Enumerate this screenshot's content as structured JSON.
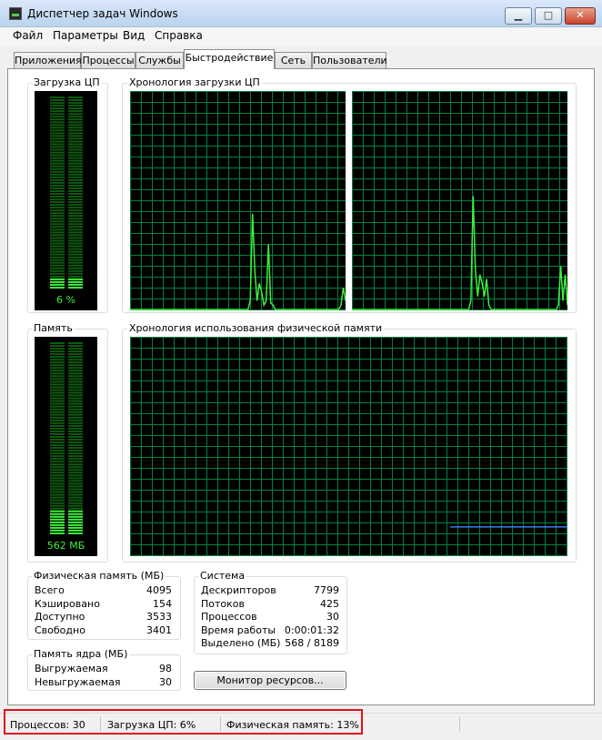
{
  "window": {
    "title": "Диспетчер задач Windows",
    "minimize": "▁",
    "maximize": "□",
    "close": "✕",
    "icon": "task-manager-icon"
  },
  "menu": [
    "Файл",
    "Параметры",
    "Вид",
    "Справка"
  ],
  "tabs": [
    "Приложения",
    "Процессы",
    "Службы",
    "Быстродействие",
    "Сеть",
    "Пользователи"
  ],
  "active_tab": "Быстродействие",
  "cpu": {
    "group_label": "Загрузка ЦП",
    "value_text": "6 %",
    "percent": 6,
    "history_label": "Хронология загрузки ЦП",
    "core1": [
      0,
      0,
      0,
      0,
      0,
      0,
      0,
      0,
      0,
      0,
      0,
      0,
      0,
      0,
      0,
      0,
      0,
      0,
      0,
      0,
      0,
      0,
      0,
      0,
      0,
      0,
      0,
      0,
      0,
      0,
      0,
      0,
      0,
      0,
      0,
      0,
      0,
      0,
      0,
      0,
      0,
      0,
      0,
      0,
      0,
      0,
      0,
      0,
      0,
      0,
      0,
      0,
      0,
      4,
      44,
      18,
      4,
      12,
      8,
      2,
      4,
      30,
      3,
      2,
      0,
      0,
      0,
      0,
      0,
      0,
      0,
      0,
      0,
      0,
      0,
      0,
      0,
      0,
      0,
      0,
      0,
      0,
      0,
      0,
      0,
      0,
      0,
      0,
      0,
      0,
      0,
      0,
      0,
      2,
      10,
      4
    ],
    "core2": [
      0,
      0,
      0,
      0,
      0,
      0,
      0,
      0,
      0,
      0,
      0,
      0,
      0,
      0,
      0,
      0,
      0,
      0,
      0,
      0,
      0,
      0,
      0,
      0,
      0,
      0,
      0,
      0,
      0,
      0,
      0,
      0,
      0,
      0,
      0,
      0,
      0,
      0,
      0,
      0,
      0,
      0,
      0,
      0,
      0,
      0,
      0,
      0,
      0,
      0,
      0,
      0,
      0,
      4,
      52,
      18,
      6,
      16,
      12,
      6,
      14,
      2,
      0,
      0,
      0,
      0,
      0,
      0,
      0,
      0,
      0,
      0,
      0,
      0,
      0,
      0,
      0,
      0,
      0,
      0,
      0,
      0,
      0,
      0,
      0,
      0,
      0,
      0,
      0,
      0,
      0,
      0,
      2,
      20,
      4,
      16,
      2
    ]
  },
  "memory": {
    "group_label": "Память",
    "value_text": "562 МБ",
    "percent": 13,
    "history_label": "Хронология использования физической памяти",
    "history": [
      0,
      0,
      0,
      0,
      0,
      0,
      0,
      0,
      0,
      0,
      0,
      0,
      0,
      0,
      0,
      0,
      0,
      0,
      0,
      0,
      0,
      0,
      0,
      0,
      0,
      0,
      0,
      0,
      0,
      0,
      0,
      0,
      0,
      0,
      0,
      0,
      0,
      0,
      0,
      0,
      0,
      0,
      0,
      0,
      0,
      0,
      0,
      0,
      0,
      0,
      0,
      0,
      0,
      0,
      0,
      0,
      0,
      0,
      0,
      0,
      0,
      0,
      0,
      0,
      0,
      0,
      0,
      0,
      0,
      0,
      0,
      13,
      13,
      13,
      13,
      13,
      13,
      13,
      13,
      13,
      13,
      13,
      13,
      13,
      13,
      13,
      13,
      13,
      13,
      13,
      13,
      13,
      13,
      13,
      13,
      13,
      13,
      13
    ]
  },
  "physical_memory": {
    "label": "Физическая память (МБ)",
    "rows": [
      {
        "label": "Всего",
        "value": "4095"
      },
      {
        "label": "Кэшировано",
        "value": "154"
      },
      {
        "label": "Доступно",
        "value": "3533"
      },
      {
        "label": "Свободно",
        "value": "3401"
      }
    ]
  },
  "kernel_memory": {
    "label": "Память ядра (МБ)",
    "rows": [
      {
        "label": "Выгружаемая",
        "value": "98"
      },
      {
        "label": "Невыгружаемая",
        "value": "30"
      }
    ]
  },
  "system": {
    "label": "Система",
    "rows": [
      {
        "label": "Дескрипторов",
        "value": "7799"
      },
      {
        "label": "Потоков",
        "value": "425"
      },
      {
        "label": "Процессов",
        "value": "30"
      },
      {
        "label": "Время работы",
        "value": "0:00:01:32"
      },
      {
        "label": "Выделено (МБ)",
        "value": "568 / 8189"
      }
    ]
  },
  "resource_monitor_button": "Монитор ресурсов...",
  "status": {
    "processes": "Процессов: 30",
    "cpu": "Загрузка ЦП: 6%",
    "memory": "Физическая память: 13%"
  },
  "colors": {
    "grid": "#008040",
    "cpu_line": "#3cf03c",
    "memory_line": "#3c78f0",
    "meter_on": "#3cf03c",
    "meter_off": "#0f5a0f",
    "highlight": "#e0101d"
  }
}
